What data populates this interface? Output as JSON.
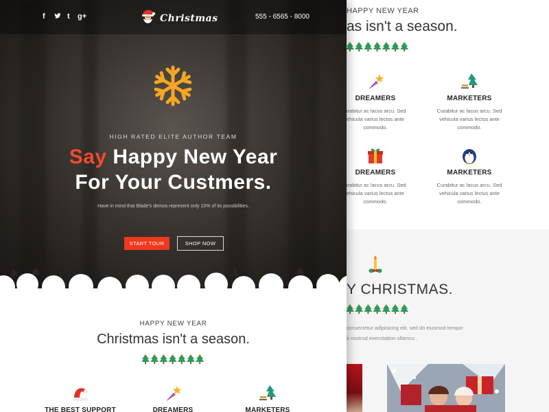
{
  "back": {
    "section_kicker": "HAPPY NEW YEAR",
    "section_title": "as isn't a season.",
    "features_row1": [
      {
        "icon": "shooting-star-icon",
        "title": "DREAMERS",
        "text": [
          "urabitur ac lacus arcu. Sed",
          "ehicula varius lectus ante",
          "commodo."
        ]
      },
      {
        "icon": "tree-sled-icon",
        "title": "MARKETERS",
        "text": [
          "Curabitur ac lacus arcu. Sed",
          "vehicula varius lectus ante",
          "commodo."
        ]
      }
    ],
    "features_row2": [
      {
        "icon": "gift-box-icon",
        "title": "DREAMERS",
        "text": [
          "urabitur ac lacus arcu. Sed",
          "ehicula varius lectus ante",
          "commodo."
        ]
      },
      {
        "icon": "penguin-icon",
        "title": "MARKETERS",
        "text": [
          "Curabitur ac lacus arcu. Sed",
          "vehicula varius lectus ante",
          "commodo."
        ]
      }
    ],
    "xmas_title": "Y CHRISTMAS.",
    "xmas_text": [
      "consectetur adipisicing elit, sed do eiusmod tempor",
      "s nostrud exercitation ullamco ."
    ]
  },
  "front": {
    "social": [
      "f",
      "t",
      "t",
      "g+"
    ],
    "logo_text": "Christmas",
    "phone": "555 - 6565 - 8000",
    "hero_kicker": "HIGH RATED ELITE AUTHOR TEAM",
    "hero_title_accent": "Say",
    "hero_title_line1_rest": " Happy New Year",
    "hero_title_line2": "For Your Custmers.",
    "hero_sub": "Have in mind that Blade's demos represent only 10% of its possibilities.",
    "btn_start": "START TOUR",
    "btn_shop": "SHOP NOW",
    "section_kicker": "HAPPY NEW YEAR",
    "section_title": "Christmas isn't a season.",
    "features": [
      {
        "icon": "santa-hat-icon",
        "title": "THE BEST SUPPORT"
      },
      {
        "icon": "shooting-star-icon",
        "title": "DREAMERS"
      },
      {
        "icon": "tree-sled-icon",
        "title": "MARKETERS"
      }
    ]
  },
  "colors": {
    "accent": "#f0391e",
    "snowflake": "#f6a623",
    "tree_green": "#2e9a5a",
    "hero_dark": "#231f1c"
  }
}
